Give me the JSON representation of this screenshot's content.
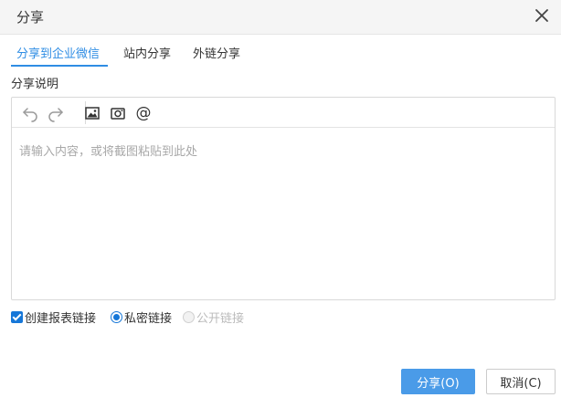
{
  "dialog": {
    "title": "分享",
    "close_icon": "close-icon"
  },
  "tabs": [
    {
      "label": "分享到企业微信",
      "active": true
    },
    {
      "label": "站内分享",
      "active": false
    },
    {
      "label": "外链分享",
      "active": false
    }
  ],
  "share_note": {
    "label": "分享说明",
    "placeholder": "请输入内容，或将截图粘贴到此处",
    "toolbar": [
      "undo-icon",
      "redo-icon",
      "image-icon",
      "screenshot-icon",
      "mention-icon"
    ],
    "mention_glyph": "@"
  },
  "options": {
    "create_link": {
      "label": "创建报表链接",
      "checked": true
    },
    "link_type": [
      {
        "label": "私密链接",
        "selected": true,
        "disabled": false
      },
      {
        "label": "公开链接",
        "selected": false,
        "disabled": true
      }
    ]
  },
  "buttons": {
    "share": "分享(O)",
    "cancel": "取消(C)"
  },
  "colors": {
    "accent": "#2f8de4",
    "primary_button": "#4a9be8",
    "checkbox": "#1677d8"
  }
}
